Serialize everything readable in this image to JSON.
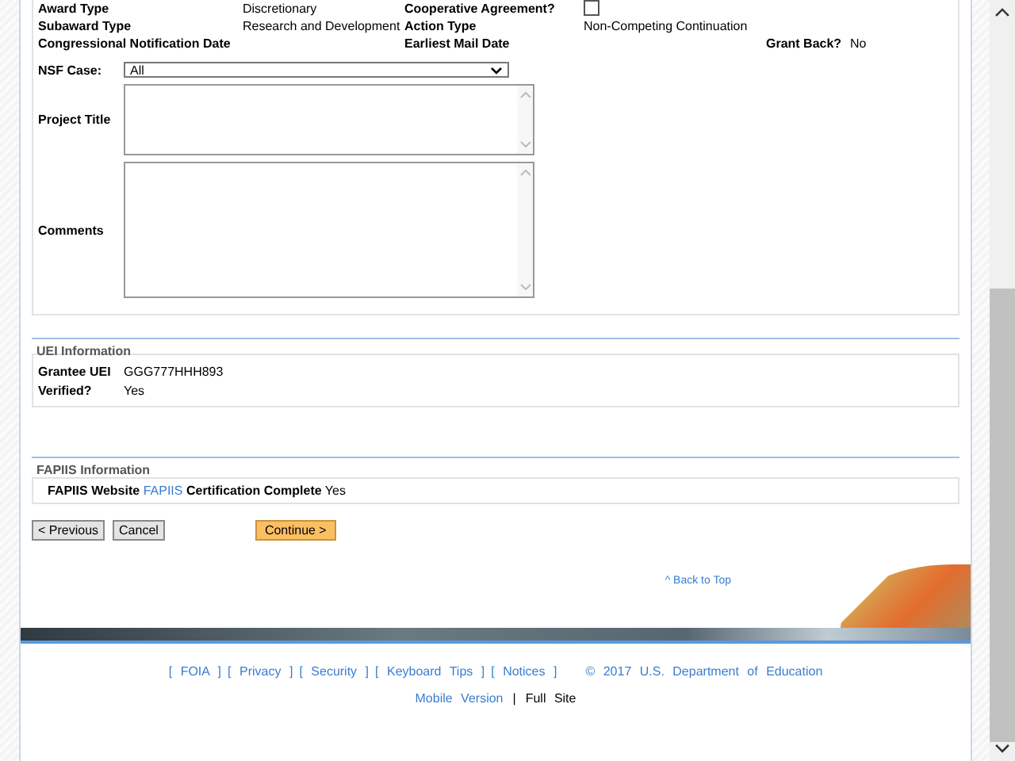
{
  "details": [
    [
      {
        "label": "Award Type",
        "value": "Discretionary"
      },
      {
        "label": "Cooperative Agreement?",
        "kind": "checkbox",
        "checked": false
      }
    ],
    [
      {
        "label": "Subaward Type",
        "value": "Research and Development"
      },
      {
        "label": "Action Type",
        "value": "Non-Competing Continuation"
      }
    ],
    [
      {
        "label": "Congressional Notification Date"
      },
      {
        "label": "Earliest Mail Date"
      },
      {
        "label": "Grant Back?",
        "value": "No"
      }
    ]
  ],
  "nsf_case": {
    "label": "NSF Case:",
    "value": "All"
  },
  "text_areas": [
    {
      "label": "Project Title",
      "kind": "short"
    },
    {
      "label": "Comments",
      "kind": "tall"
    }
  ],
  "uei": {
    "legend": "UEI Information",
    "rows": [
      {
        "label": "Grantee UEI",
        "value": "GGG777HHH893"
      },
      {
        "label": "Verified?",
        "value": "Yes"
      }
    ]
  },
  "fapiis": {
    "legend": "FAPIIS Information",
    "label": "FAPIIS Website",
    "link": "FAPIIS",
    "status_label": "Certification Complete",
    "status": "Yes"
  },
  "buttons": [
    {
      "label": "< Previous",
      "kind": "plain"
    },
    {
      "label": "Cancel",
      "kind": "plain"
    },
    {
      "label": "Continue >",
      "kind": "primary"
    }
  ],
  "back_to_top": "^ Back to Top",
  "footer": {
    "links": [
      {
        "open": "[",
        "label": "FOIA",
        "close": "]"
      },
      {
        "open": "[",
        "label": "Privacy",
        "close": "]"
      },
      {
        "open": "[",
        "label": "Security",
        "close": "]"
      },
      {
        "open": "[",
        "label": "Keyboard Tips",
        "close": "]"
      },
      {
        "open": "[",
        "label": "Notices",
        "close": "]"
      }
    ],
    "copyright": "© 2017 U.S. Department of Education",
    "mobile": "Mobile Version",
    "separator": "|",
    "full": "Full Site"
  }
}
